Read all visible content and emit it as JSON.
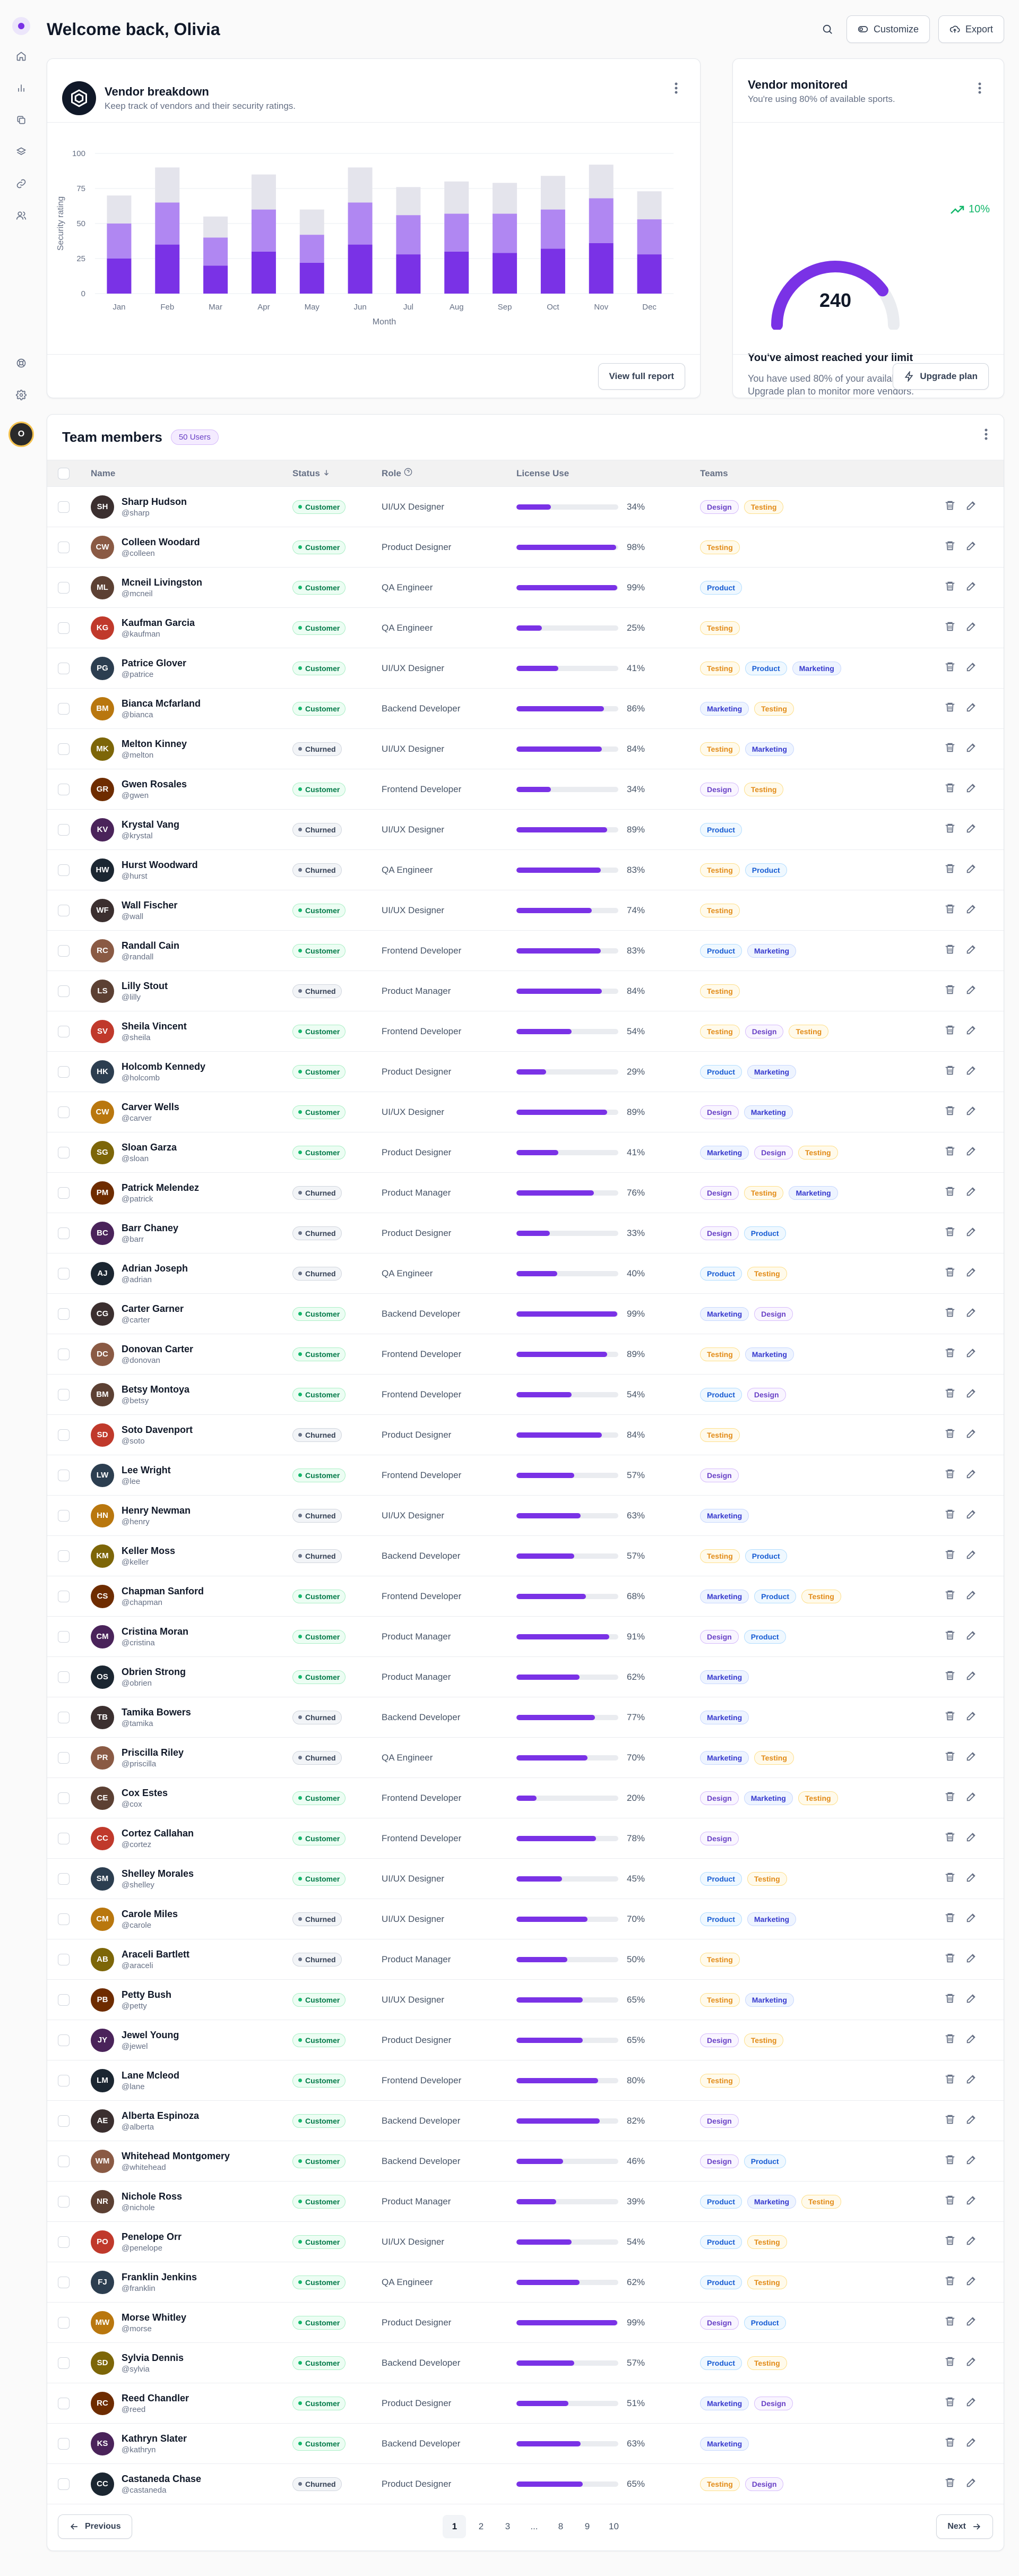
{
  "header": {
    "title": "Welcome back, Olivia",
    "customize_label": "Customize",
    "export_label": "Export"
  },
  "sidebar": {
    "items": [
      "home-icon",
      "chart-icon",
      "layers-icon",
      "stack-icon",
      "link-icon",
      "users-icon"
    ],
    "bottom_items": [
      "support-icon",
      "settings-icon"
    ],
    "avatar_initials": "O"
  },
  "vendor_breakdown": {
    "title": "Vendor breakdown",
    "subtitle": "Keep track of vendors and their security ratings.",
    "button_label": "View full report",
    "colors": [
      "#7a32e6",
      "#b087f2",
      "#e4e4ec"
    ]
  },
  "chart_data": {
    "type": "bar",
    "stacked": true,
    "categories": [
      "Jan",
      "Feb",
      "Mar",
      "Apr",
      "May",
      "Jun",
      "Jul",
      "Aug",
      "Sep",
      "Oct",
      "Nov",
      "Dec"
    ],
    "series": [
      {
        "values": [
          25,
          35,
          20,
          30,
          22,
          35,
          28,
          30,
          29,
          32,
          36,
          28
        ]
      },
      {
        "values": [
          25,
          30,
          20,
          30,
          20,
          30,
          28,
          27,
          28,
          28,
          32,
          25
        ]
      },
      {
        "values": [
          20,
          25,
          15,
          25,
          18,
          25,
          20,
          23,
          22,
          24,
          24,
          20
        ]
      }
    ],
    "xlabel": "Month",
    "ylabel": "Security rating",
    "ylim": [
      0,
      100
    ],
    "yticks": [
      0,
      25,
      50,
      75,
      100
    ],
    "grid": true
  },
  "vendor_monitored": {
    "title": "Vendor monitored",
    "subtitle": "You're using 80% of available sports.",
    "trend": "10%",
    "gauge_value": "240",
    "gauge_fraction": 0.8,
    "heading": "You've almost reached your limit",
    "text": "You have used 80% of your available spots. Upgrade plan to monitor more vendors.",
    "button_label": "Upgrade plan"
  },
  "team": {
    "title": "Team members",
    "badge": "50 Users",
    "columns": {
      "name": "Name",
      "status": "Status",
      "role": "Role",
      "license": "License Use",
      "teams": "Teams"
    },
    "rows": [
      {
        "name": "Sharp Hudson",
        "handle": "@sharp",
        "status": "Customer",
        "role": "UI/UX Designer",
        "license": 34,
        "teams": [
          "Design",
          "Testing"
        ]
      },
      {
        "name": "Colleen Woodard",
        "handle": "@colleen",
        "status": "Customer",
        "role": "Product Designer",
        "license": 98,
        "teams": [
          "Testing"
        ]
      },
      {
        "name": "Mcneil Livingston",
        "handle": "@mcneil",
        "status": "Customer",
        "role": "QA Engineer",
        "license": 99,
        "teams": [
          "Product"
        ]
      },
      {
        "name": "Kaufman Garcia",
        "handle": "@kaufman",
        "status": "Customer",
        "role": "QA Engineer",
        "license": 25,
        "teams": [
          "Testing"
        ]
      },
      {
        "name": "Patrice Glover",
        "handle": "@patrice",
        "status": "Customer",
        "role": "UI/UX Designer",
        "license": 41,
        "teams": [
          "Testing",
          "Product",
          "Marketing"
        ]
      },
      {
        "name": "Bianca Mcfarland",
        "handle": "@bianca",
        "status": "Customer",
        "role": "Backend Developer",
        "license": 86,
        "teams": [
          "Marketing",
          "Testing"
        ]
      },
      {
        "name": "Melton Kinney",
        "handle": "@melton",
        "status": "Churned",
        "role": "UI/UX Designer",
        "license": 84,
        "teams": [
          "Testing",
          "Marketing"
        ]
      },
      {
        "name": "Gwen Rosales",
        "handle": "@gwen",
        "status": "Customer",
        "role": "Frontend Developer",
        "license": 34,
        "teams": [
          "Design",
          "Testing"
        ]
      },
      {
        "name": "Krystal Vang",
        "handle": "@krystal",
        "status": "Churned",
        "role": "UI/UX Designer",
        "license": 89,
        "teams": [
          "Product"
        ]
      },
      {
        "name": "Hurst Woodward",
        "handle": "@hurst",
        "status": "Churned",
        "role": "QA Engineer",
        "license": 83,
        "teams": [
          "Testing",
          "Product"
        ]
      },
      {
        "name": "Wall Fischer",
        "handle": "@wall",
        "status": "Customer",
        "role": "UI/UX Designer",
        "license": 74,
        "teams": [
          "Testing"
        ]
      },
      {
        "name": "Randall Cain",
        "handle": "@randall",
        "status": "Customer",
        "role": "Frontend Developer",
        "license": 83,
        "teams": [
          "Product",
          "Marketing"
        ]
      },
      {
        "name": "Lilly Stout",
        "handle": "@lilly",
        "status": "Churned",
        "role": "Product Manager",
        "license": 84,
        "teams": [
          "Testing"
        ]
      },
      {
        "name": "Sheila Vincent",
        "handle": "@sheila",
        "status": "Customer",
        "role": "Frontend Developer",
        "license": 54,
        "teams": [
          "Testing",
          "Design",
          "Testing"
        ]
      },
      {
        "name": "Holcomb Kennedy",
        "handle": "@holcomb",
        "status": "Customer",
        "role": "Product Designer",
        "license": 29,
        "teams": [
          "Product",
          "Marketing"
        ]
      },
      {
        "name": "Carver Wells",
        "handle": "@carver",
        "status": "Customer",
        "role": "UI/UX Designer",
        "license": 89,
        "teams": [
          "Design",
          "Marketing"
        ]
      },
      {
        "name": "Sloan Garza",
        "handle": "@sloan",
        "status": "Customer",
        "role": "Product Designer",
        "license": 41,
        "teams": [
          "Marketing",
          "Design",
          "Testing"
        ]
      },
      {
        "name": "Patrick Melendez",
        "handle": "@patrick",
        "status": "Churned",
        "role": "Product Manager",
        "license": 76,
        "teams": [
          "Design",
          "Testing",
          "Marketing"
        ]
      },
      {
        "name": "Barr Chaney",
        "handle": "@barr",
        "status": "Churned",
        "role": "Product Designer",
        "license": 33,
        "teams": [
          "Design",
          "Product"
        ]
      },
      {
        "name": "Adrian Joseph",
        "handle": "@adrian",
        "status": "Churned",
        "role": "QA Engineer",
        "license": 40,
        "teams": [
          "Product",
          "Testing"
        ]
      },
      {
        "name": "Carter Garner",
        "handle": "@carter",
        "status": "Customer",
        "role": "Backend Developer",
        "license": 99,
        "teams": [
          "Marketing",
          "Design"
        ]
      },
      {
        "name": "Donovan Carter",
        "handle": "@donovan",
        "status": "Customer",
        "role": "Frontend Developer",
        "license": 89,
        "teams": [
          "Testing",
          "Marketing"
        ]
      },
      {
        "name": "Betsy Montoya",
        "handle": "@betsy",
        "status": "Customer",
        "role": "Frontend Developer",
        "license": 54,
        "teams": [
          "Product",
          "Design"
        ]
      },
      {
        "name": "Soto Davenport",
        "handle": "@soto",
        "status": "Churned",
        "role": "Product Designer",
        "license": 84,
        "teams": [
          "Testing"
        ]
      },
      {
        "name": "Lee Wright",
        "handle": "@lee",
        "status": "Customer",
        "role": "Frontend Developer",
        "license": 57,
        "teams": [
          "Design"
        ]
      },
      {
        "name": "Henry Newman",
        "handle": "@henry",
        "status": "Churned",
        "role": "UI/UX Designer",
        "license": 63,
        "teams": [
          "Marketing"
        ]
      },
      {
        "name": "Keller Moss",
        "handle": "@keller",
        "status": "Churned",
        "role": "Backend Developer",
        "license": 57,
        "teams": [
          "Testing",
          "Product"
        ]
      },
      {
        "name": "Chapman Sanford",
        "handle": "@chapman",
        "status": "Customer",
        "role": "Frontend Developer",
        "license": 68,
        "teams": [
          "Marketing",
          "Product",
          "Testing"
        ]
      },
      {
        "name": "Cristina Moran",
        "handle": "@cristina",
        "status": "Customer",
        "role": "Product Manager",
        "license": 91,
        "teams": [
          "Design",
          "Product"
        ]
      },
      {
        "name": "Obrien Strong",
        "handle": "@obrien",
        "status": "Customer",
        "role": "Product Manager",
        "license": 62,
        "teams": [
          "Marketing"
        ]
      },
      {
        "name": "Tamika Bowers",
        "handle": "@tamika",
        "status": "Churned",
        "role": "Backend Developer",
        "license": 77,
        "teams": [
          "Marketing"
        ]
      },
      {
        "name": "Priscilla Riley",
        "handle": "@priscilla",
        "status": "Churned",
        "role": "QA Engineer",
        "license": 70,
        "teams": [
          "Marketing",
          "Testing"
        ]
      },
      {
        "name": "Cox Estes",
        "handle": "@cox",
        "status": "Customer",
        "role": "Frontend Developer",
        "license": 20,
        "teams": [
          "Design",
          "Marketing",
          "Testing"
        ]
      },
      {
        "name": "Cortez Callahan",
        "handle": "@cortez",
        "status": "Customer",
        "role": "Frontend Developer",
        "license": 78,
        "teams": [
          "Design"
        ]
      },
      {
        "name": "Shelley Morales",
        "handle": "@shelley",
        "status": "Customer",
        "role": "UI/UX Designer",
        "license": 45,
        "teams": [
          "Product",
          "Testing"
        ]
      },
      {
        "name": "Carole Miles",
        "handle": "@carole",
        "status": "Churned",
        "role": "UI/UX Designer",
        "license": 70,
        "teams": [
          "Product",
          "Marketing"
        ]
      },
      {
        "name": "Araceli Bartlett",
        "handle": "@araceli",
        "status": "Churned",
        "role": "Product Manager",
        "license": 50,
        "teams": [
          "Testing"
        ]
      },
      {
        "name": "Petty Bush",
        "handle": "@petty",
        "status": "Customer",
        "role": "UI/UX Designer",
        "license": 65,
        "teams": [
          "Testing",
          "Marketing"
        ]
      },
      {
        "name": "Jewel Young",
        "handle": "@jewel",
        "status": "Customer",
        "role": "Product Designer",
        "license": 65,
        "teams": [
          "Design",
          "Testing"
        ]
      },
      {
        "name": "Lane Mcleod",
        "handle": "@lane",
        "status": "Customer",
        "role": "Frontend Developer",
        "license": 80,
        "teams": [
          "Testing"
        ]
      },
      {
        "name": "Alberta Espinoza",
        "handle": "@alberta",
        "status": "Customer",
        "role": "Backend Developer",
        "license": 82,
        "teams": [
          "Design"
        ]
      },
      {
        "name": "Whitehead Montgomery",
        "handle": "@whitehead",
        "status": "Customer",
        "role": "Backend Developer",
        "license": 46,
        "teams": [
          "Design",
          "Product"
        ]
      },
      {
        "name": "Nichole Ross",
        "handle": "@nichole",
        "status": "Customer",
        "role": "Product Manager",
        "license": 39,
        "teams": [
          "Product",
          "Marketing",
          "Testing"
        ]
      },
      {
        "name": "Penelope Orr",
        "handle": "@penelope",
        "status": "Customer",
        "role": "UI/UX Designer",
        "license": 54,
        "teams": [
          "Product",
          "Testing"
        ]
      },
      {
        "name": "Franklin Jenkins",
        "handle": "@franklin",
        "status": "Customer",
        "role": "QA Engineer",
        "license": 62,
        "teams": [
          "Product",
          "Testing"
        ]
      },
      {
        "name": "Morse Whitley",
        "handle": "@morse",
        "status": "Customer",
        "role": "Product Designer",
        "license": 99,
        "teams": [
          "Design",
          "Product"
        ]
      },
      {
        "name": "Sylvia Dennis",
        "handle": "@sylvia",
        "status": "Customer",
        "role": "Backend Developer",
        "license": 57,
        "teams": [
          "Product",
          "Testing"
        ]
      },
      {
        "name": "Reed Chandler",
        "handle": "@reed",
        "status": "Customer",
        "role": "Product Designer",
        "license": 51,
        "teams": [
          "Marketing",
          "Design"
        ]
      },
      {
        "name": "Kathryn Slater",
        "handle": "@kathryn",
        "status": "Customer",
        "role": "Backend Developer",
        "license": 63,
        "teams": [
          "Marketing"
        ]
      },
      {
        "name": "Castaneda Chase",
        "handle": "@castaneda",
        "status": "Churned",
        "role": "Product Designer",
        "license": 65,
        "teams": [
          "Testing",
          "Design"
        ]
      }
    ]
  },
  "pagination": {
    "previous_label": "Previous",
    "next_label": "Next",
    "pages": [
      "1",
      "2",
      "3",
      "...",
      "8",
      "9",
      "10"
    ],
    "current": "1"
  }
}
